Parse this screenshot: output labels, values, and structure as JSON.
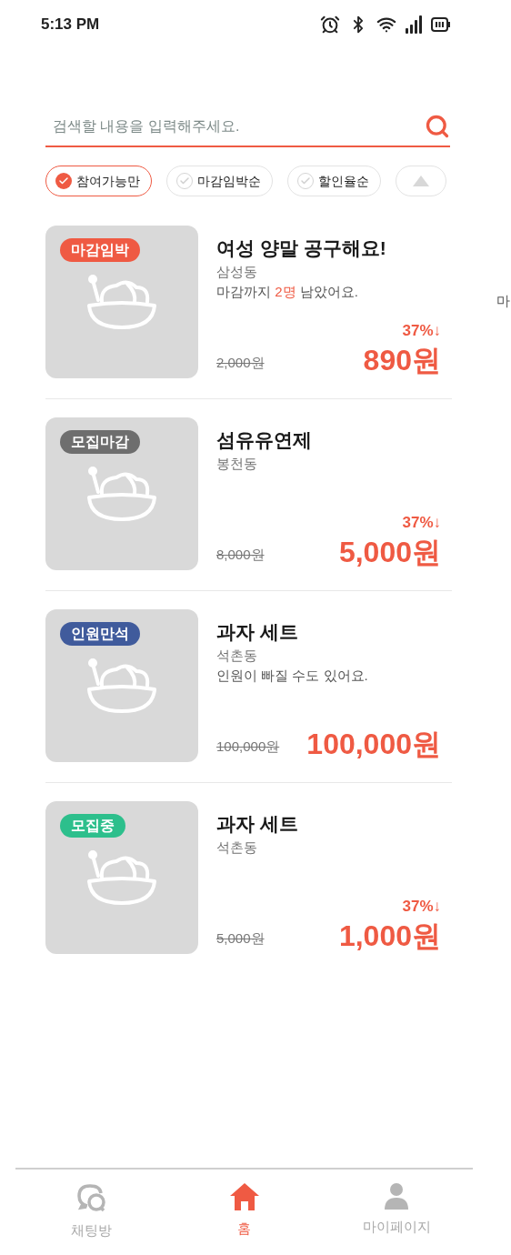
{
  "status_bar": {
    "time": "5:13 PM"
  },
  "search": {
    "placeholder": "검색할 내용을 입력해주세요."
  },
  "filters": [
    {
      "kind": "filter",
      "label": "참여가능만",
      "selected": true
    },
    {
      "kind": "filter",
      "label": "마감임박순",
      "selected": false
    },
    {
      "kind": "filter",
      "label": "할인율순",
      "selected": false
    },
    {
      "kind": "collapse"
    }
  ],
  "items": [
    {
      "badge": {
        "label": "마감임박",
        "color": "#ef5a43"
      },
      "title": "여성 양말 공구해요!",
      "location": "삼성동",
      "note": [
        {
          "text": "마감까지 ",
          "highlight": false
        },
        {
          "text": "2명",
          "highlight": true
        },
        {
          "text": " 남았어요.",
          "highlight": false
        }
      ],
      "discount": "37%↓",
      "original_price": "2,000원",
      "price": "890원"
    },
    {
      "badge": {
        "label": "모집마감",
        "color": "#6e6e6e"
      },
      "title": "섬유유연제",
      "location": "봉천동",
      "discount": "37%↓",
      "original_price": "8,000원",
      "price": "5,000원"
    },
    {
      "badge": {
        "label": "인원만석",
        "color": "#405b9c"
      },
      "title": "과자 세트",
      "location": "석촌동",
      "note": [
        {
          "text": "인원이 빠질 수도 있어요.",
          "highlight": false
        }
      ],
      "original_price": "100,000원",
      "price": "100,000원"
    },
    {
      "badge": {
        "label": "모집중",
        "color": "#2dbf8c"
      },
      "title": "과자 세트",
      "location": "석촌동",
      "discount": "37%↓",
      "original_price": "5,000원",
      "price": "1,000원"
    }
  ],
  "edge_text": "마",
  "bottom_nav": [
    {
      "label": "채팅방",
      "selected": false
    },
    {
      "label": "홈",
      "selected": true
    },
    {
      "label": "마이페이지",
      "selected": false
    }
  ]
}
